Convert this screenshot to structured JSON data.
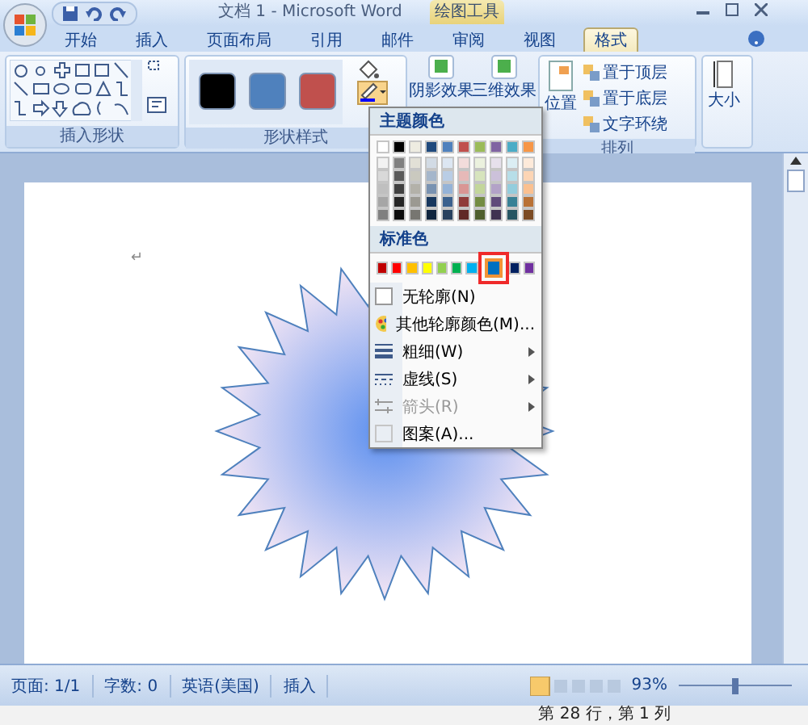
{
  "title_bar": {
    "title": "文档 1 - Microsoft Word",
    "context_tab": "绘图工具"
  },
  "tabs": [
    {
      "label": "开始",
      "selected": false
    },
    {
      "label": "插入",
      "selected": false
    },
    {
      "label": "页面布局",
      "selected": false
    },
    {
      "label": "引用",
      "selected": false
    },
    {
      "label": "邮件",
      "selected": false
    },
    {
      "label": "审阅",
      "selected": false
    },
    {
      "label": "视图",
      "selected": false
    },
    {
      "label": "格式",
      "selected": true
    }
  ],
  "ribbon": {
    "shapes_label": "插入形状",
    "styles_label": "形状样式",
    "style_swatches": [
      {
        "color": "#000000"
      },
      {
        "color": "#4f81bd"
      },
      {
        "color": "#c0504d"
      }
    ],
    "effects": [
      "阴影效果",
      "三维效果"
    ],
    "position": "位置",
    "arrange_items": [
      "置于顶层",
      "置于底层",
      "文字环绕"
    ],
    "arrange_label": "排列",
    "size": "大小"
  },
  "outline_menu": {
    "theme_header": "主题颜色",
    "theme_colors": [
      {
        "color": "#ffffff"
      },
      {
        "color": "#000000"
      },
      {
        "color": "#eeece1"
      },
      {
        "color": "#1f497d"
      },
      {
        "color": "#4f81bd"
      },
      {
        "color": "#c0504d"
      },
      {
        "color": "#9bbb59"
      },
      {
        "color": "#8064a2"
      },
      {
        "color": "#4bacc6"
      },
      {
        "color": "#f79646"
      }
    ],
    "standard_header": "标准色",
    "standard_colors": [
      {
        "color": "#c00000",
        "selected": false
      },
      {
        "color": "#ff0000",
        "selected": false
      },
      {
        "color": "#ffc000",
        "selected": false
      },
      {
        "color": "#ffff00",
        "selected": false
      },
      {
        "color": "#92d050",
        "selected": false
      },
      {
        "color": "#00b050",
        "selected": false
      },
      {
        "color": "#00b0f0",
        "selected": false
      },
      {
        "color": "#0070c0",
        "selected": true
      },
      {
        "color": "#002060",
        "selected": false
      },
      {
        "color": "#7030a0",
        "selected": false
      }
    ],
    "items": [
      {
        "kind": "none",
        "label": "无轮廓(N)",
        "submenu": false,
        "disabled": false
      },
      {
        "kind": "palette",
        "label": "其他轮廓颜色(M)...",
        "submenu": false,
        "disabled": false
      },
      {
        "kind": "weight",
        "label": "粗细(W)",
        "submenu": true,
        "disabled": false
      },
      {
        "kind": "dash",
        "label": "虚线(S)",
        "submenu": true,
        "disabled": false
      },
      {
        "kind": "arrow",
        "label": "箭头(R)",
        "submenu": true,
        "disabled": true
      },
      {
        "kind": "pattern",
        "label": "图案(A)...",
        "submenu": false,
        "disabled": false
      }
    ]
  },
  "document": {
    "paragraph_mark": "↵"
  },
  "status_bar": {
    "items": [
      "页面: 1/1",
      "字数: 0",
      "英语(美国)",
      "插入"
    ],
    "zoom": "93%",
    "zoom_slider": {
      "level": 0.5
    }
  },
  "position_bar": {
    "text": "第 28 行，第 1 列"
  }
}
